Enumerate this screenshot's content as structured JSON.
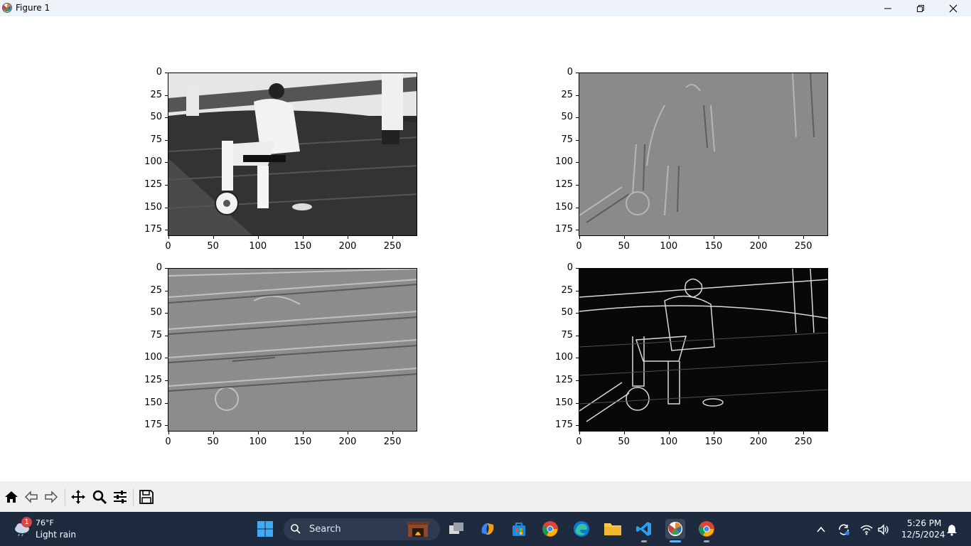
{
  "window": {
    "title": "Figure 1",
    "icon": "matplotlib-icon",
    "controls": [
      "minimize-icon",
      "restore-icon",
      "close-icon"
    ]
  },
  "figure": {
    "subplots": [
      {
        "image": "grayscale football player sitting on chair with ball",
        "yticks": [
          "0",
          "25",
          "50",
          "75",
          "100",
          "125",
          "150",
          "175"
        ],
        "xticks": [
          "0",
          "50",
          "100",
          "150",
          "200",
          "250"
        ]
      },
      {
        "image": "horizontal Sobel edge response (gray relief)",
        "yticks": [
          "0",
          "25",
          "50",
          "75",
          "100",
          "125",
          "150",
          "175"
        ],
        "xticks": [
          "0",
          "50",
          "100",
          "150",
          "200",
          "250"
        ]
      },
      {
        "image": "vertical Sobel edge response (gray relief)",
        "yticks": [
          "0",
          "25",
          "50",
          "75",
          "100",
          "125",
          "150",
          "175"
        ],
        "xticks": [
          "0",
          "50",
          "100",
          "150",
          "200",
          "250"
        ]
      },
      {
        "image": "gradient magnitude edges (white on black)",
        "yticks": [
          "0",
          "25",
          "50",
          "75",
          "100",
          "125",
          "150",
          "175"
        ],
        "xticks": [
          "0",
          "50",
          "100",
          "150",
          "200",
          "250"
        ]
      }
    ]
  },
  "toolbar": {
    "buttons": [
      "home-icon",
      "back-icon",
      "forward-icon",
      "pan-icon",
      "zoom-icon",
      "configure-subplots-icon",
      "save-icon"
    ]
  },
  "taskbar": {
    "weather": {
      "badge": "1",
      "temp": "76°F",
      "desc": "Light rain"
    },
    "search_label": "Search",
    "apps": [
      "file-explorer-widget-icon",
      "task-view-icon",
      "copilot-icon",
      "microsoft-store-icon",
      "chrome-icon",
      "edge-icon",
      "folder-icon",
      "vscode-icon",
      "matplotlib-app-icon",
      "chrome-icon-2"
    ],
    "clock": {
      "time": "5:26 PM",
      "date": "12/5/2024"
    }
  },
  "colors": {
    "titlebar": "#eef3fa",
    "taskbar": "#1e2a3e",
    "toolbar": "#f0f0f0"
  }
}
